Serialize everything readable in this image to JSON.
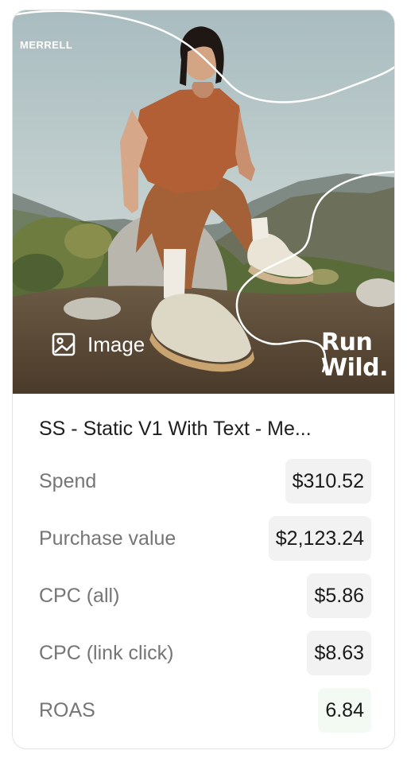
{
  "image": {
    "brand": "MERRELL",
    "badge_icon": "image-icon",
    "badge_label": "Image",
    "tagline_line1": "Run",
    "tagline_line2": "Wild."
  },
  "ad": {
    "title": "SS - Static V1 With Text - Me..."
  },
  "metrics": [
    {
      "label": "Spend",
      "value": "$310.52"
    },
    {
      "label": "Purchase value",
      "value": "$2,123.24"
    },
    {
      "label": "CPC (all)",
      "value": "$5.86"
    },
    {
      "label": "CPC (link click)",
      "value": "$8.63"
    },
    {
      "label": "ROAS",
      "value": "6.84"
    }
  ],
  "colors": {
    "card_border": "#e3e3e3",
    "value_bg": "#f2f2f2",
    "roas_bg": "#f2faf3"
  }
}
